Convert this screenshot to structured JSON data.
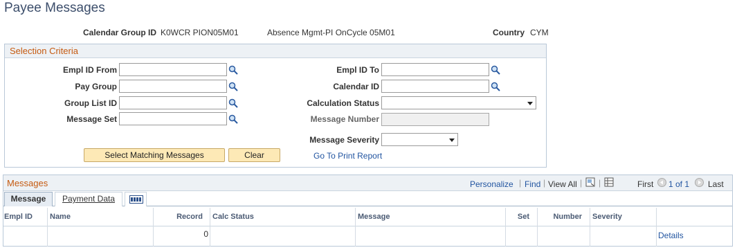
{
  "page": {
    "title": "Payee Messages"
  },
  "info": {
    "calendar_group_label": "Calendar Group ID",
    "calendar_group_value": "K0WCR PION05M01",
    "calendar_group_desc": "Absence Mgmt-PI OnCycle 05M01",
    "country_label": "Country",
    "country_value": "CYM"
  },
  "criteria": {
    "header": "Selection Criteria",
    "empl_from_label": "Empl ID From",
    "empl_to_label": "Empl ID To",
    "pay_group_label": "Pay Group",
    "calendar_id_label": "Calendar ID",
    "group_list_label": "Group List ID",
    "calc_status_label": "Calculation Status",
    "message_set_label": "Message Set",
    "message_number_label": "Message Number",
    "message_severity_label": "Message Severity",
    "select_button": "Select Matching Messages",
    "clear_button": "Clear",
    "print_link": "Go To Print Report"
  },
  "messages": {
    "header": "Messages",
    "personalize": "Personalize",
    "find": "Find",
    "view_all": "View All",
    "first": "First",
    "range": "1 of 1",
    "last": "Last",
    "tabs": [
      "Message",
      "Payment Data"
    ],
    "columns": [
      "Empl ID",
      "Name",
      "Record",
      "Calc Status",
      "Message",
      "Set",
      "Number",
      "Severity"
    ],
    "rows": [
      {
        "empl_id": "",
        "name": "",
        "record": "0",
        "calc_status": "",
        "message": "",
        "set": "",
        "number": "",
        "severity": "",
        "details": "Details"
      }
    ]
  },
  "icons": {
    "lookup": "magnifier-icon",
    "prev": "prev-arrow-icon",
    "next": "next-arrow-icon",
    "zoom": "zoom-icon",
    "download": "download-icon",
    "grid": "show-all-columns-icon"
  }
}
